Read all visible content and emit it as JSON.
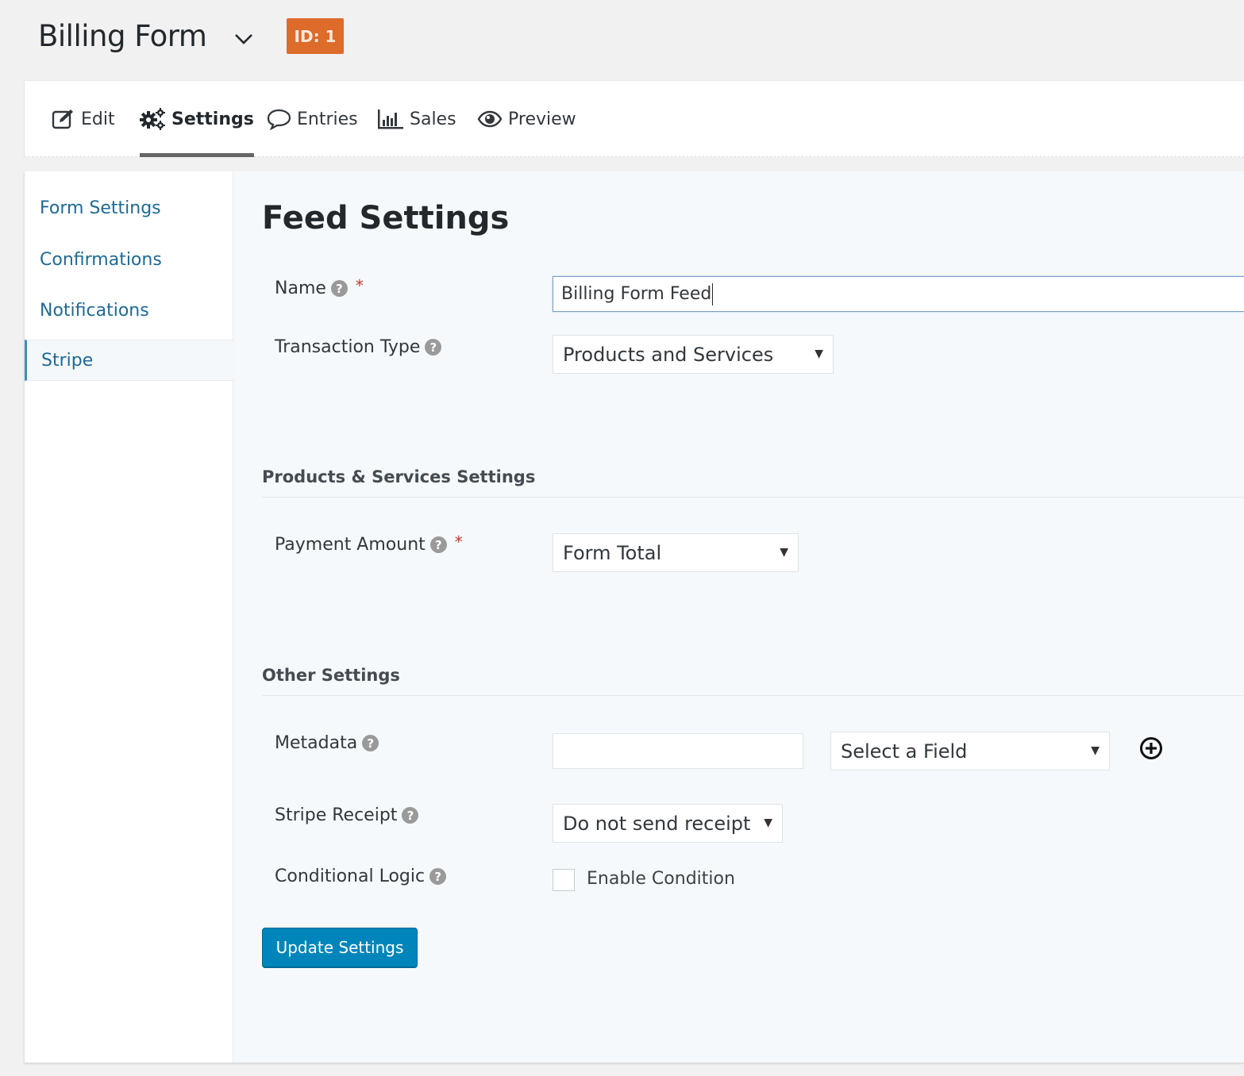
{
  "header": {
    "form_title": "Billing Form",
    "id_badge": "ID: 1",
    "id_badge_color": "#dd6b2a"
  },
  "tabs": [
    {
      "label": "Edit",
      "icon": "edit-icon",
      "active": false
    },
    {
      "label": "Settings",
      "icon": "gears-icon",
      "active": true
    },
    {
      "label": "Entries",
      "icon": "comment-icon",
      "active": false
    },
    {
      "label": "Sales",
      "icon": "bar-chart-icon",
      "active": false
    },
    {
      "label": "Preview",
      "icon": "eye-icon",
      "active": false
    }
  ],
  "sidebar": {
    "items": [
      {
        "label": "Form Settings",
        "active": false
      },
      {
        "label": "Confirmations",
        "active": false
      },
      {
        "label": "Notifications",
        "active": false
      },
      {
        "label": "Stripe",
        "active": true
      }
    ]
  },
  "main": {
    "title": "Feed Settings",
    "fields": {
      "name": {
        "label": "Name",
        "help": "?",
        "required": "*",
        "value": "Billing Form Feed"
      },
      "transaction_type": {
        "label": "Transaction Type",
        "help": "?",
        "selected": "Products and Services"
      },
      "payment_amount": {
        "label": "Payment Amount",
        "help": "?",
        "required": "*",
        "selected": "Form Total"
      },
      "metadata": {
        "label": "Metadata",
        "help": "?",
        "key_value": "",
        "field_selected": "Select a Field"
      },
      "stripe_receipt": {
        "label": "Stripe Receipt",
        "help": "?",
        "selected": "Do not send receipt"
      },
      "conditional_logic": {
        "label": "Conditional Logic",
        "help": "?",
        "checkbox_label": "Enable Condition",
        "checked": false
      }
    },
    "sections": {
      "products": "Products & Services Settings",
      "other": "Other Settings"
    },
    "submit_label": "Update Settings",
    "accent_color": "#0085ba"
  },
  "glyphs": {
    "dropdown_arrow": "▼"
  }
}
